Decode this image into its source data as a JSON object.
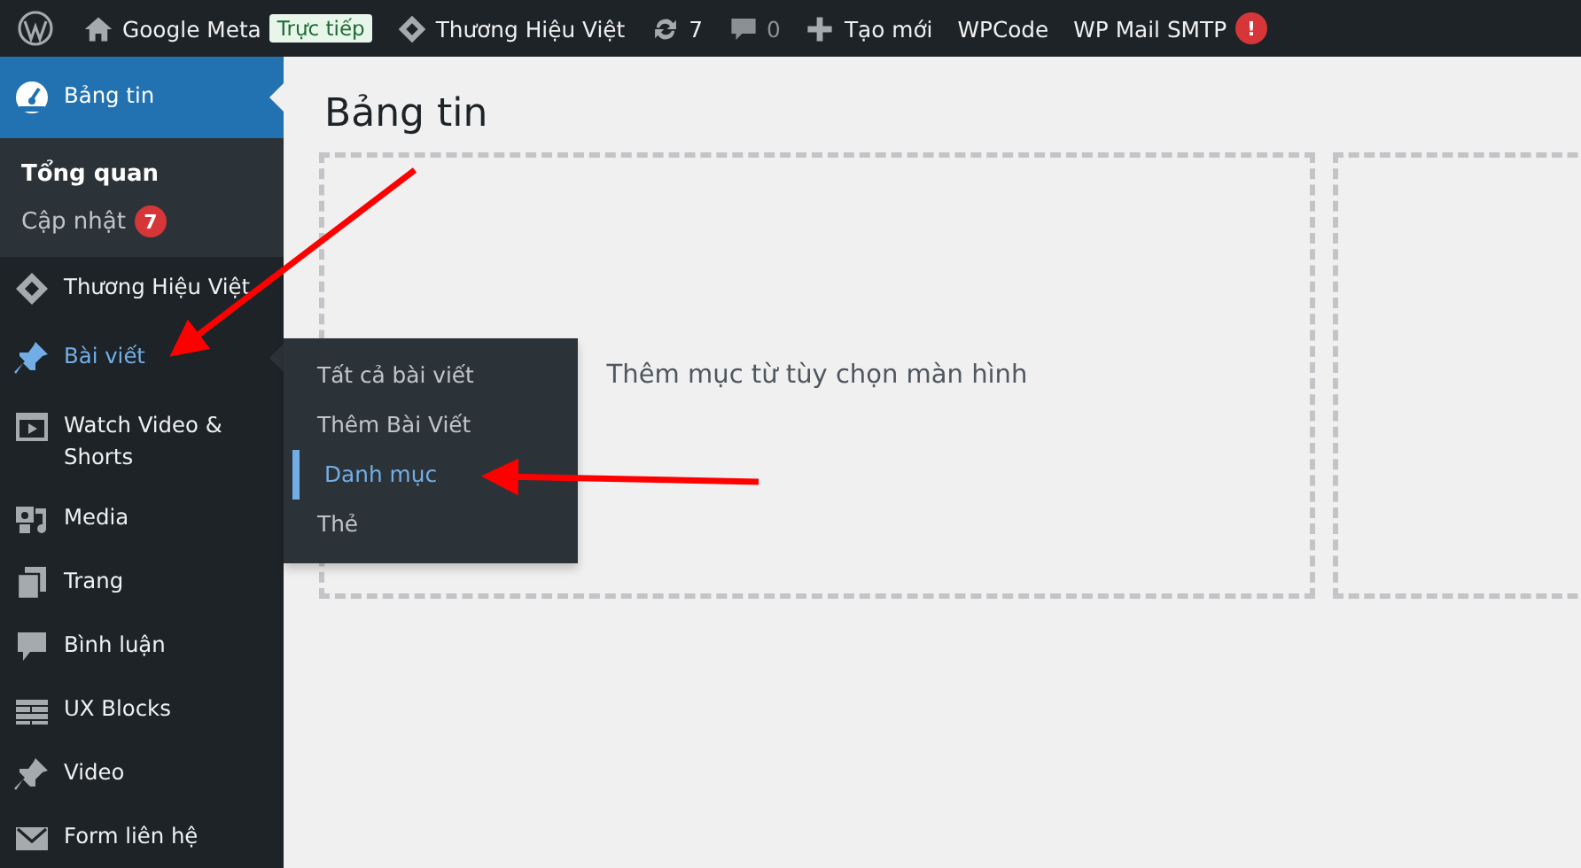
{
  "admin_bar": {
    "site": "Google Meta",
    "live_badge": "Trực tiếp",
    "brand": "Thương Hiệu Việt",
    "updates": "7",
    "comments": "0",
    "new": "Tạo mới",
    "wpcode": "WPCode",
    "mail_smtp": "WP Mail SMTP",
    "mail_alert": "!"
  },
  "sidebar": {
    "items": [
      {
        "label": "Bảng tin",
        "selected": true,
        "hovered": false,
        "children": [
          {
            "label": "Tổng quan",
            "current": true
          },
          {
            "label": "Cập nhật",
            "current": false,
            "badge": "7"
          }
        ]
      },
      {
        "label": "Thương Hiệu Việt",
        "selected": false,
        "hovered": false
      },
      {
        "label": "Bài viết",
        "selected": false,
        "hovered": true
      },
      {
        "label": "Watch Video & Shorts",
        "selected": false,
        "hovered": false
      },
      {
        "label": "Media",
        "selected": false,
        "hovered": false
      },
      {
        "label": "Trang",
        "selected": false,
        "hovered": false
      },
      {
        "label": "Bình luận",
        "selected": false,
        "hovered": false
      },
      {
        "label": "UX Blocks",
        "selected": false,
        "hovered": false
      },
      {
        "label": "Video",
        "selected": false,
        "hovered": false
      },
      {
        "label": "Form liên hệ",
        "selected": false,
        "hovered": false
      }
    ]
  },
  "flyout": {
    "items": [
      {
        "label": "Tất cả bài viết",
        "selected": false
      },
      {
        "label": "Thêm Bài Viết",
        "selected": false
      },
      {
        "label": "Danh mục",
        "selected": true
      },
      {
        "label": "Thẻ",
        "selected": false
      }
    ]
  },
  "main": {
    "title": "Bảng tin",
    "empty_hint": "Thêm mục từ tùy chọn màn hình"
  }
}
